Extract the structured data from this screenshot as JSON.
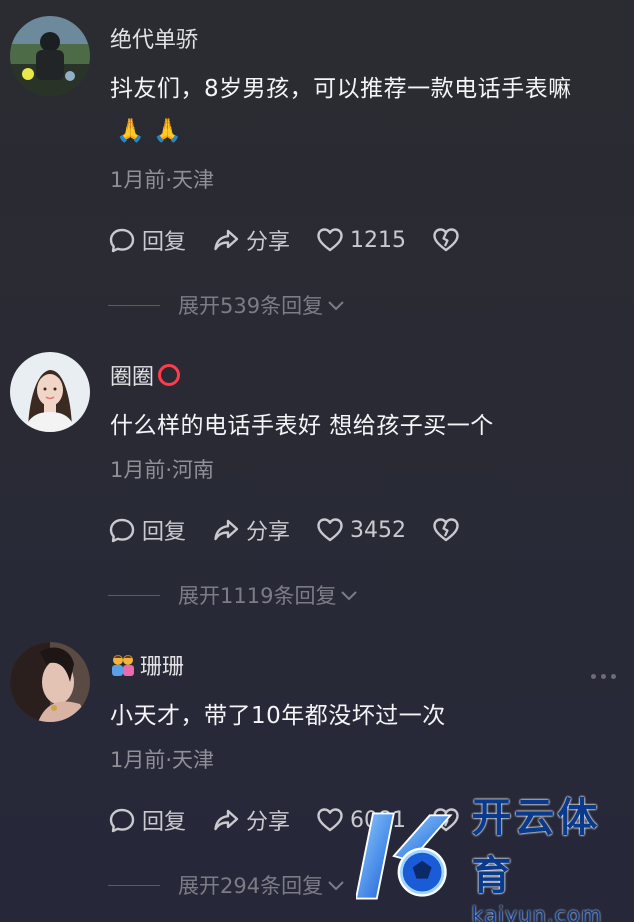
{
  "comments": [
    {
      "username": "绝代单骄",
      "text": "抖友们，8岁男孩，可以推荐一款电话手表嘛",
      "emoji": "🙏 🙏",
      "meta": "1月前·天津",
      "reply_label": "回复",
      "share_label": "分享",
      "likes": "1215",
      "expand_label": "展开539条回复"
    },
    {
      "username": "圈圈",
      "text": "什么样的电话手表好 想给孩子买一个",
      "meta": "1月前·河南",
      "reply_label": "回复",
      "share_label": "分享",
      "likes": "3452",
      "expand_label": "展开1119条回复"
    },
    {
      "username": "珊珊",
      "text": "小天才，带了10年都没坏过一次",
      "meta": "1月前·天津",
      "reply_label": "回复",
      "share_label": "分享",
      "likes": "6081",
      "expand_label": "展开294条回复"
    }
  ],
  "watermark": {
    "cn": "开云体育",
    "en": "kaiyun.com"
  },
  "colors": {
    "background": "#2a2b33",
    "accent_red": "#ff3b4d",
    "muted": "#8e8f97",
    "watermark_blue": "#0a3a8c"
  }
}
